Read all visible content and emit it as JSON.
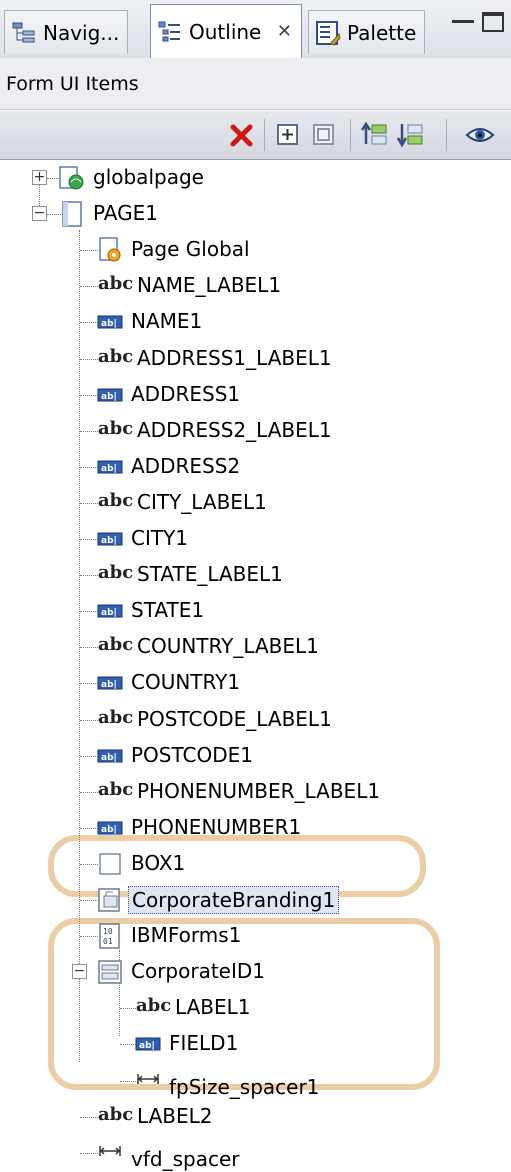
{
  "tabs": [
    {
      "label": "Navig...",
      "icon": "navigator-icon",
      "active": false
    },
    {
      "label": "Outline",
      "icon": "outline-icon",
      "active": true,
      "close": "✕"
    },
    {
      "label": "Palette",
      "icon": "palette-icon",
      "active": false
    }
  ],
  "header": {
    "title": "Form UI Items"
  },
  "toolbar": {
    "buttons": [
      "delete-icon",
      "expand-all-icon",
      "collapse-all-icon",
      "move-up-icon",
      "move-down-icon",
      "view-icon"
    ]
  },
  "tree": {
    "items": [
      {
        "label": "globalpage",
        "icon": "globalpage-icon"
      },
      {
        "label": "PAGE1",
        "icon": "page-icon"
      },
      {
        "label": "Page Global",
        "icon": "page-global-icon"
      },
      {
        "label": "NAME_LABEL1",
        "icon": "abc"
      },
      {
        "label": "NAME1",
        "icon": "field-icon"
      },
      {
        "label": "ADDRESS1_LABEL1",
        "icon": "abc"
      },
      {
        "label": "ADDRESS1",
        "icon": "field-icon"
      },
      {
        "label": "ADDRESS2_LABEL1",
        "icon": "abc"
      },
      {
        "label": "ADDRESS2",
        "icon": "field-icon"
      },
      {
        "label": "CITY_LABEL1",
        "icon": "abc"
      },
      {
        "label": "CITY1",
        "icon": "field-icon"
      },
      {
        "label": "STATE_LABEL1",
        "icon": "abc"
      },
      {
        "label": "STATE1",
        "icon": "field-icon"
      },
      {
        "label": "COUNTRY_LABEL1",
        "icon": "abc"
      },
      {
        "label": "COUNTRY1",
        "icon": "field-icon"
      },
      {
        "label": "POSTCODE_LABEL1",
        "icon": "abc"
      },
      {
        "label": "POSTCODE1",
        "icon": "field-icon"
      },
      {
        "label": "PHONENUMBER_LABEL1",
        "icon": "abc"
      },
      {
        "label": "PHONENUMBER1",
        "icon": "field-icon"
      },
      {
        "label": "BOX1",
        "icon": "box-icon"
      },
      {
        "label": "CorporateBranding1",
        "icon": "branding-icon",
        "selected": true
      },
      {
        "label": "IBMForms1",
        "icon": "ibmforms-icon"
      },
      {
        "label": "CorporateID1",
        "icon": "group-icon"
      },
      {
        "label": "LABEL1",
        "icon": "abc"
      },
      {
        "label": "FIELD1",
        "icon": "field-icon"
      },
      {
        "label": "fpSize_spacer1",
        "icon": "spacer-icon"
      },
      {
        "label": "LABEL2",
        "icon": "abc"
      },
      {
        "label": "vfd_spacer",
        "icon": "spacer-icon"
      }
    ],
    "abc_text": "abc",
    "expand_plus": "+",
    "expand_minus": "−"
  },
  "colors": {
    "selection": "#dfe6f2",
    "highlight_ring": "#e8c496"
  }
}
